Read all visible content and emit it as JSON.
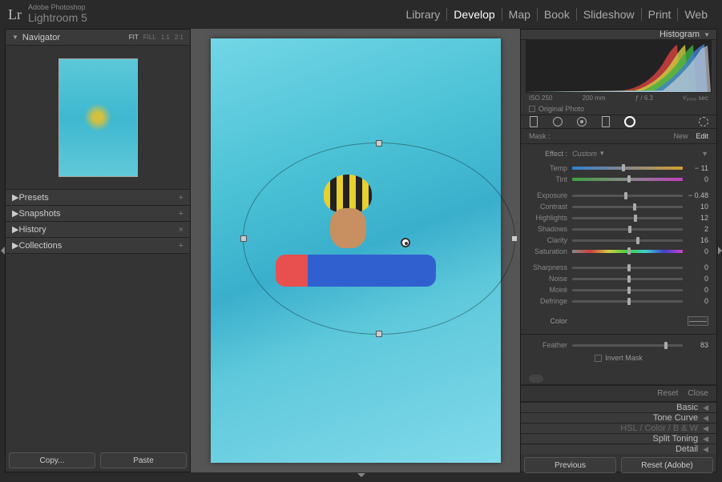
{
  "app": {
    "adobe": "Adobe Photoshop",
    "name": "Lightroom 5",
    "logo": "Lr"
  },
  "modules": [
    "Library",
    "Develop",
    "Map",
    "Book",
    "Slideshow",
    "Print",
    "Web"
  ],
  "active_module": "Develop",
  "left_panels": {
    "navigator": {
      "title": "Navigator",
      "zoom_modes": [
        "FIT",
        "FILL",
        "1:1",
        "2:1"
      ]
    },
    "rows": [
      {
        "title": "Presets",
        "tail": "+"
      },
      {
        "title": "Snapshots",
        "tail": "+"
      },
      {
        "title": "History",
        "tail": "×"
      },
      {
        "title": "Collections",
        "tail": "+"
      }
    ],
    "copy_btn": "Copy...",
    "paste_btn": "Paste"
  },
  "histogram": {
    "title": "Histogram",
    "iso": "ISO 250",
    "focal": "200 mm",
    "aperture": "ƒ / 6.3",
    "shutter": "¹⁄₂₀₀₀ sec",
    "original": "Original Photo"
  },
  "mask": {
    "label": "Mask :",
    "new": "New",
    "edit": "Edit",
    "effect_label": "Effect :",
    "effect_value": "Custom",
    "sliders": {
      "temp": {
        "label": "Temp",
        "value": "− 11",
        "pos": 45
      },
      "tint": {
        "label": "Tint",
        "value": "0",
        "pos": 50
      },
      "exposure": {
        "label": "Exposure",
        "value": "− 0.48",
        "pos": 47
      },
      "contrast": {
        "label": "Contrast",
        "value": "10",
        "pos": 55
      },
      "highlights": {
        "label": "Highlights",
        "value": "12",
        "pos": 56
      },
      "shadows": {
        "label": "Shadows",
        "value": "2",
        "pos": 51
      },
      "clarity": {
        "label": "Clarity",
        "value": "16",
        "pos": 58
      },
      "saturation": {
        "label": "Saturation",
        "value": "0",
        "pos": 50
      },
      "sharpness": {
        "label": "Sharpness",
        "value": "0",
        "pos": 50
      },
      "noise": {
        "label": "Noise",
        "value": "0",
        "pos": 50
      },
      "moire": {
        "label": "Moiré",
        "value": "0",
        "pos": 50
      },
      "defringe": {
        "label": "Defringe",
        "value": "0",
        "pos": 50
      }
    },
    "color_label": "Color",
    "feather": {
      "label": "Feather",
      "value": "83",
      "pos": 83
    },
    "invert": "Invert Mask",
    "reset": "Reset",
    "close": "Close"
  },
  "right_collapsed": [
    {
      "text": "Basic"
    },
    {
      "text": "Tone Curve"
    },
    {
      "text": "HSL / Color / B & W",
      "dim": true
    },
    {
      "text": "Split Toning"
    },
    {
      "text": "Detail"
    }
  ],
  "right_buttons": {
    "previous": "Previous",
    "reset": "Reset (Adobe)"
  }
}
